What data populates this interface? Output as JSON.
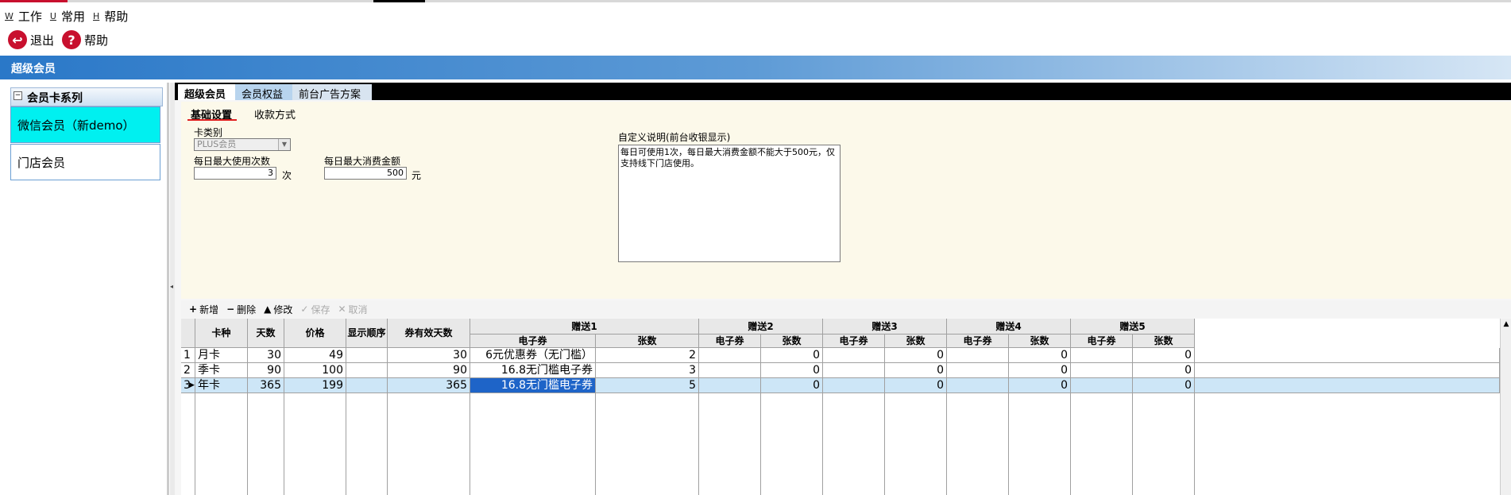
{
  "menu": [
    {
      "key": "W",
      "label": "工作"
    },
    {
      "key": "U",
      "label": "常用"
    },
    {
      "key": "H",
      "label": "帮助"
    }
  ],
  "toolbar": {
    "exit_label": "退出",
    "help_label": "帮助"
  },
  "title_band": "超级会员",
  "sidebar": {
    "group_label": "会员卡系列",
    "items": [
      {
        "label": "微信会员（新demo）"
      },
      {
        "label": "门店会员"
      }
    ]
  },
  "tabs": [
    "超级会员",
    "会员权益",
    "前台广告方案"
  ],
  "subtabs": [
    "基础设置",
    "收款方式"
  ],
  "form": {
    "card_type_label": "卡类别",
    "card_type_value": "PLUS会员",
    "max_use_label": "每日最大使用次数",
    "max_use_value": "3",
    "max_use_unit": "次",
    "max_amount_label": "每日最大消费金额",
    "max_amount_value": "500",
    "max_amount_unit": "元",
    "desc_label": "自定义说明(前台收银显示)",
    "desc_value": "每日可使用1次，每日最大消费金额不能大于500元，仅支持线下门店使用。"
  },
  "grid_toolbar": {
    "add": "新增",
    "delete": "删除",
    "edit": "修改",
    "save": "保存",
    "cancel": "取消"
  },
  "table": {
    "headers": [
      "卡种",
      "天数",
      "价格",
      "显示顺序",
      "券有效天数"
    ],
    "groups": [
      "赠送1",
      "赠送2",
      "赠送3",
      "赠送4",
      "赠送5"
    ],
    "sub_headers": [
      "电子券",
      "张数"
    ],
    "rows": [
      {
        "num": "1",
        "name": "月卡",
        "days": "30",
        "price": "49",
        "order": "",
        "valid": "30",
        "g": [
          [
            "6元优惠券（无门槛）",
            "2"
          ],
          [
            "",
            "0"
          ],
          [
            "",
            "0"
          ],
          [
            "",
            "0"
          ],
          [
            "",
            "0"
          ]
        ]
      },
      {
        "num": "2",
        "name": "季卡",
        "days": "90",
        "price": "100",
        "order": "",
        "valid": "90",
        "g": [
          [
            "16.8无门槛电子券",
            "3"
          ],
          [
            "",
            "0"
          ],
          [
            "",
            "0"
          ],
          [
            "",
            "0"
          ],
          [
            "",
            "0"
          ]
        ]
      },
      {
        "num": "3",
        "name": "年卡",
        "days": "365",
        "price": "199",
        "order": "",
        "valid": "365",
        "g": [
          [
            "16.8无门槛电子券",
            "5"
          ],
          [
            "",
            "0"
          ],
          [
            "",
            "0"
          ],
          [
            "",
            "0"
          ],
          [
            "",
            "0"
          ]
        ]
      }
    ]
  },
  "colors": {
    "accent": "#2a78c8",
    "selected_row": "#cde6f7",
    "selected_cell": "#1e64c8",
    "sidebar_active": "#00f0f0"
  }
}
